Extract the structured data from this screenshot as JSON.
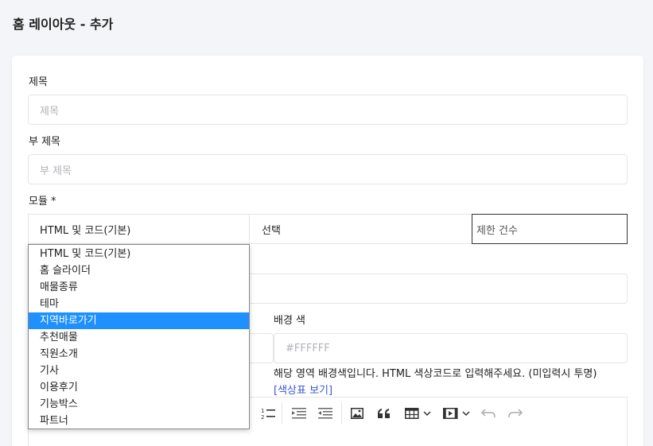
{
  "page": {
    "title": "홈 레이아웃 - 추가"
  },
  "form": {
    "title_label": "제목",
    "title_placeholder": "제목",
    "subtitle_label": "부 제목",
    "subtitle_placeholder": "부 제목",
    "module_label": "모듈 *",
    "module_selected": "HTML 및 코드(기본)",
    "select_label": "선택",
    "limit_placeholder": "제한 건수",
    "bg_color_label": "배경 색",
    "bg_color_placeholder": "#FFFFFF",
    "bg_color_help": "해당 영역 배경색입니다. HTML 색상코드로 입력해주세요. (미입력시 투명)",
    "color_chart_link": "[색상표 보기]"
  },
  "dropdown": {
    "options": [
      "HTML 및 코드(기본)",
      "홈 슬라이더",
      "매물종류",
      "테마",
      "지역바로가기",
      "추천매물",
      "직원소개",
      "기사",
      "이용후기",
      "기능박스",
      "파트너"
    ],
    "highlighted": "지역바로가기"
  },
  "toolbar": {
    "icons": [
      "ordered-list-icon",
      "indent-icon",
      "outdent-icon",
      "image-icon",
      "blockquote-icon",
      "table-icon",
      "media-icon",
      "undo-icon",
      "redo-icon"
    ]
  },
  "colors": {
    "highlight": "#1e90ff",
    "link": "#3a56d4",
    "background": "#f4f5f9"
  }
}
